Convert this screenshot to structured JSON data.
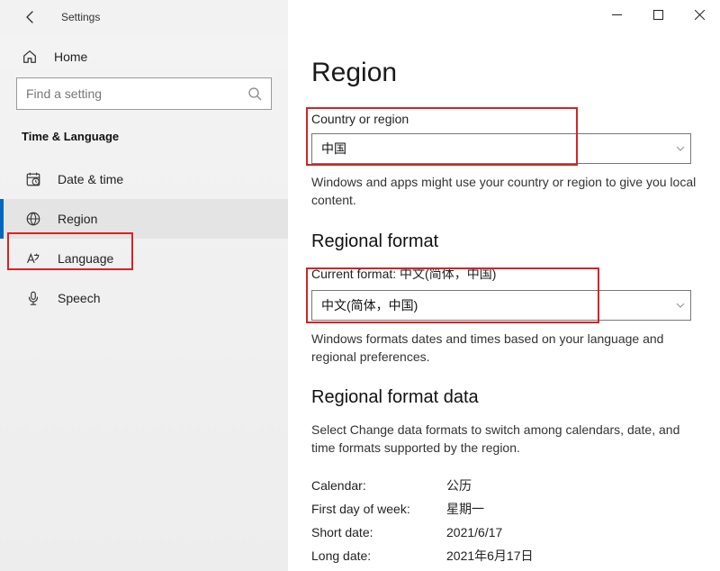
{
  "titlebar": {
    "title": "Settings"
  },
  "sidebar": {
    "home": "Home",
    "search_placeholder": "Find a setting",
    "category": "Time & Language",
    "items": [
      {
        "icon": "clock",
        "label": "Date & time"
      },
      {
        "icon": "globe",
        "label": "Region"
      },
      {
        "icon": "letter",
        "label": "Language"
      },
      {
        "icon": "mic",
        "label": "Speech"
      }
    ],
    "active_index": 1
  },
  "main": {
    "title": "Region",
    "country": {
      "label": "Country or region",
      "value": "中国",
      "help": "Windows and apps might use your country or region to give you local content."
    },
    "regional_format": {
      "heading": "Regional format",
      "current_label_prefix": "Current format: ",
      "current_value": "中文(简体，中国)",
      "dropdown_value": "中文(简体，中国)",
      "help": "Windows formats dates and times based on your language and regional preferences."
    },
    "format_data": {
      "heading": "Regional format data",
      "help": "Select Change data formats to switch among calendars, date, and time formats supported by the region.",
      "rows": [
        {
          "key": "Calendar:",
          "val": "公历"
        },
        {
          "key": "First day of week:",
          "val": "星期一"
        },
        {
          "key": "Short date:",
          "val": "2021/6/17"
        },
        {
          "key": "Long date:",
          "val": "2021年6月17日"
        }
      ]
    }
  }
}
